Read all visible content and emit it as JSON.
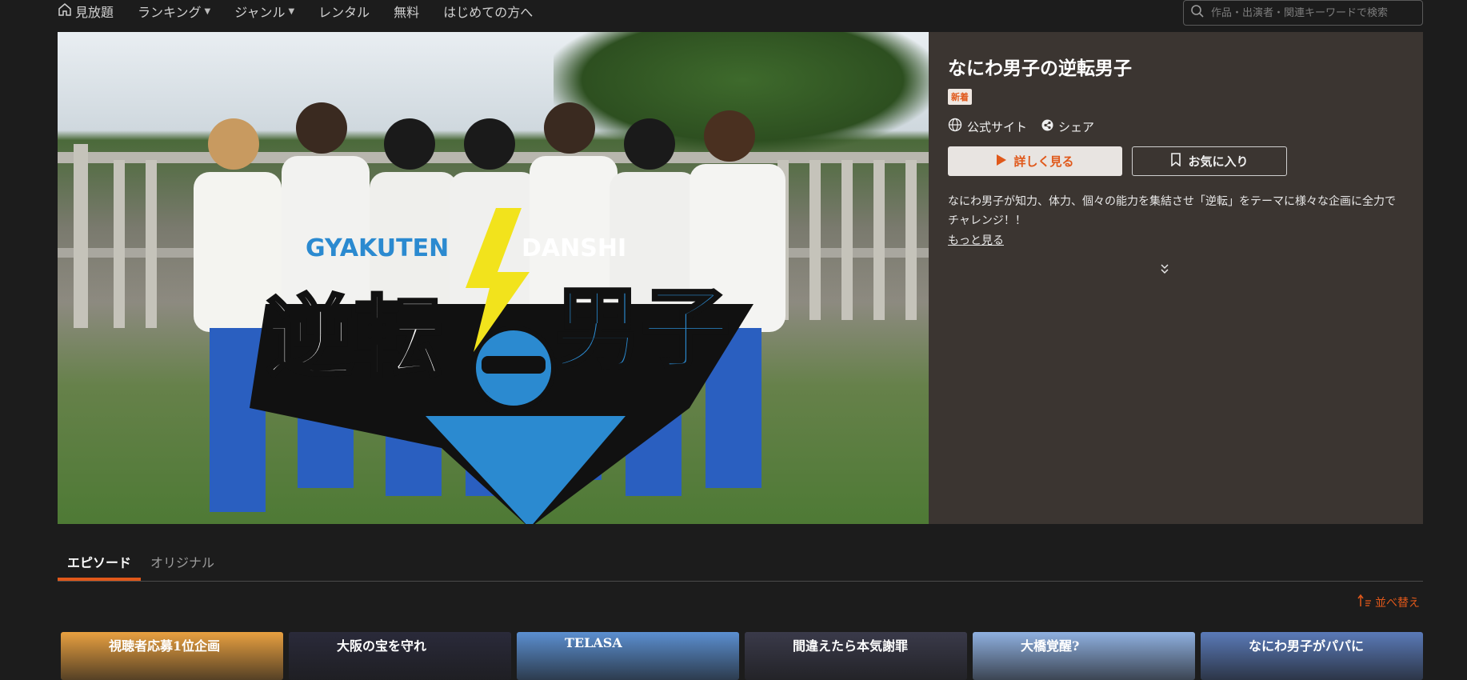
{
  "nav": {
    "home_label": "見放題",
    "ranking_label": "ランキング",
    "genre_label": "ジャンル",
    "rental_label": "レンタル",
    "free_label": "無料",
    "first_time_label": "はじめての方へ"
  },
  "search": {
    "placeholder": "作品・出演者・関連キーワードで検索"
  },
  "hero": {
    "logo_top_left": "GYAKUTEN",
    "logo_top_right": "DANSHI",
    "logo_main_left": "逆転",
    "logo_main_right": "男子"
  },
  "detail": {
    "title": "なにわ男子の逆転男子",
    "badge": "新着",
    "official_site": "公式サイト",
    "share": "シェア",
    "watch_label": "詳しく見る",
    "favorite_label": "お気に入り",
    "description": "なにわ男子が知力、体力、個々の能力を集結させ「逆転」をテーマに様々な企画に全力でチャレンジ！！",
    "more_label": "もっと見る"
  },
  "tabs": [
    {
      "label": "エピソード",
      "active": true
    },
    {
      "label": "オリジナル",
      "active": false
    }
  ],
  "sort_label": "並べ替え",
  "thumbnails": [
    {
      "caption": "視聴者応募1位企画",
      "color": "#e8a040"
    },
    {
      "caption": "大阪の宝を守れ",
      "color": "#2a2a3a"
    },
    {
      "caption": "TELASA",
      "color": "#5b8fd0"
    },
    {
      "caption": "間違えたら本気謝罪",
      "color": "#3a3a4a"
    },
    {
      "caption": "大橋覚醒?",
      "color": "#8fb0e0"
    },
    {
      "caption": "なにわ男子がパパに",
      "color": "#5a7ab8"
    }
  ],
  "colors": {
    "accent": "#e0581a",
    "panel": "#3b3531",
    "background": "#1c1c1c"
  }
}
